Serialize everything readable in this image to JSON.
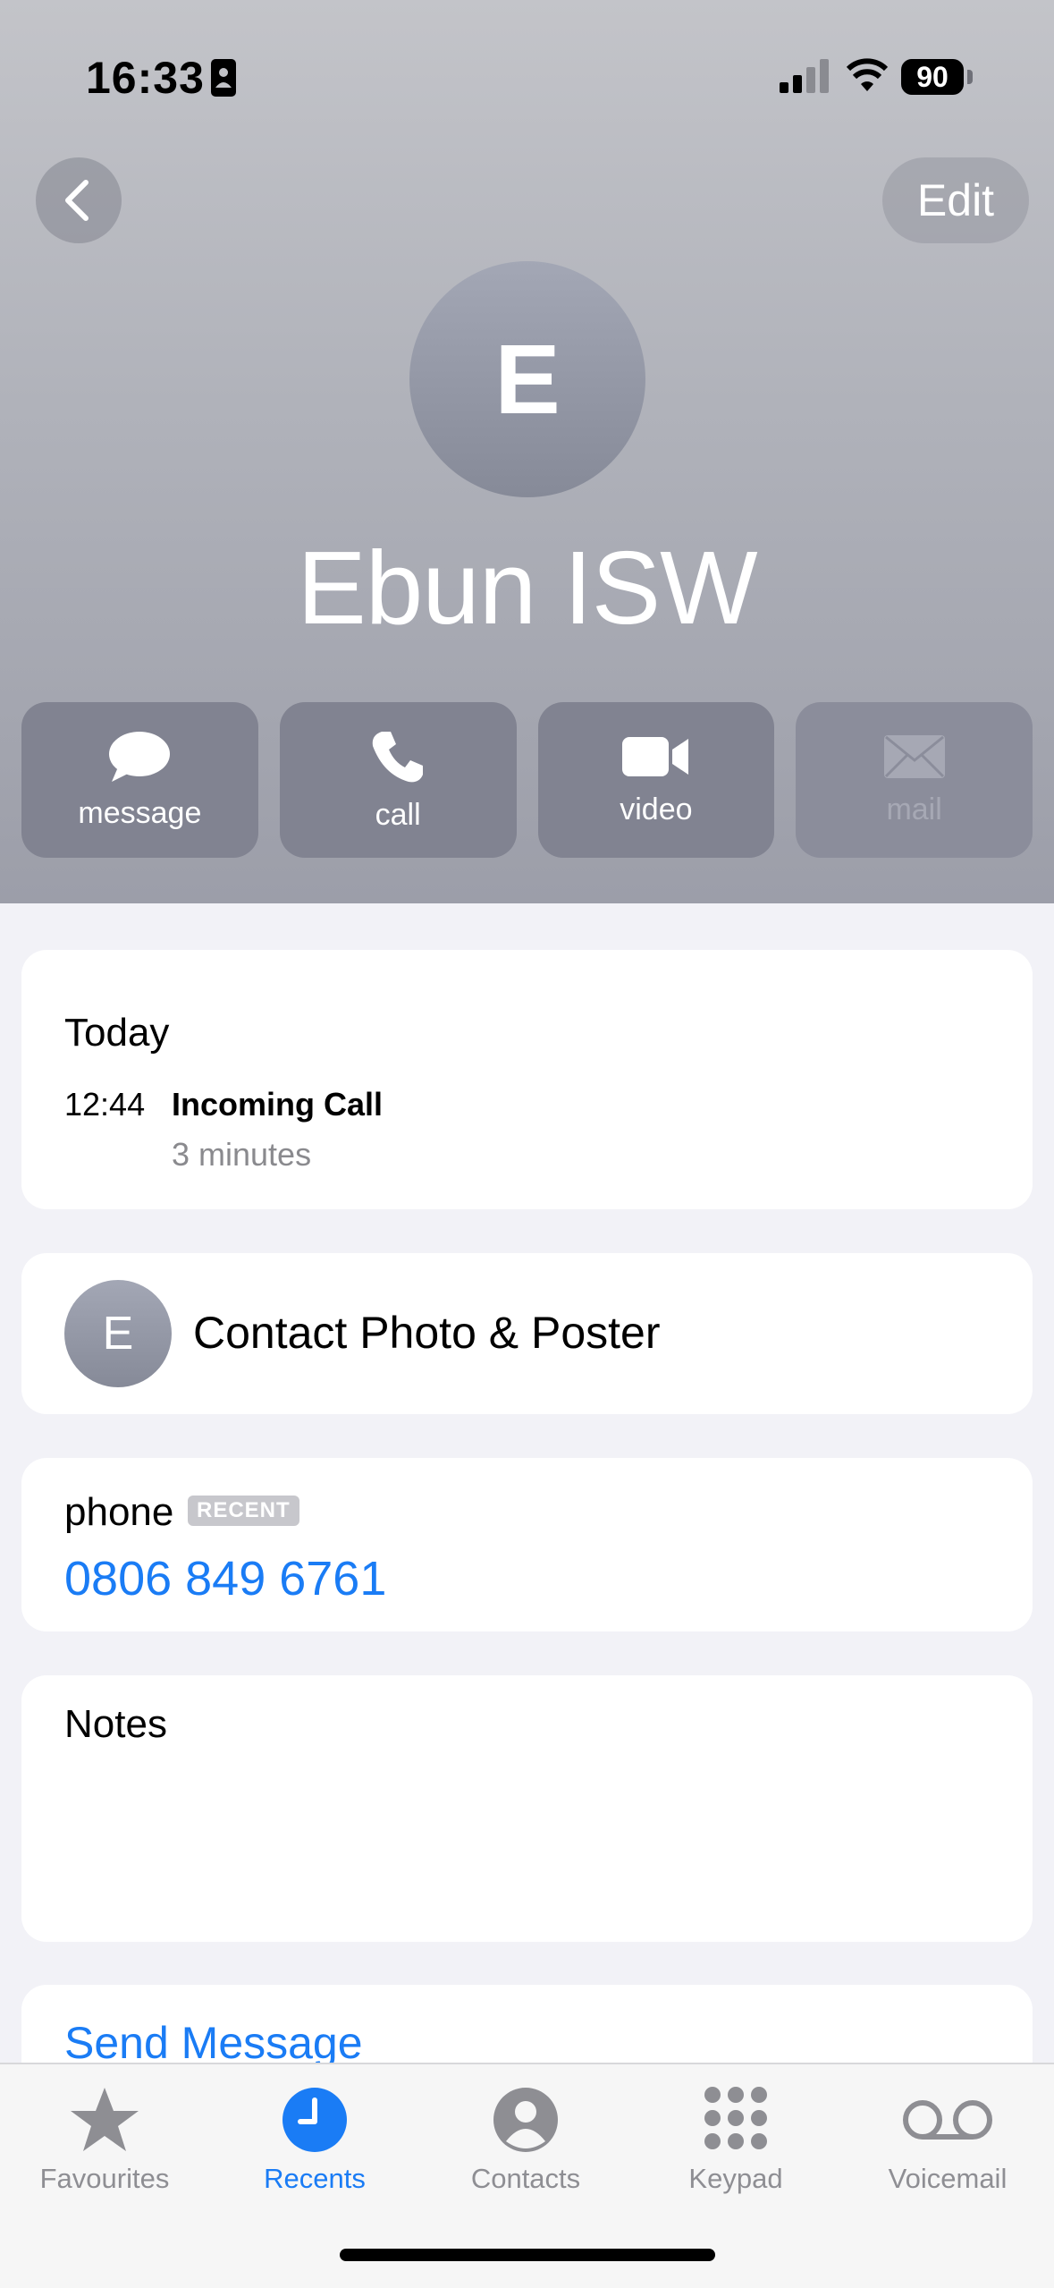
{
  "status_bar": {
    "time": "16:33",
    "battery": "90"
  },
  "nav": {
    "edit_label": "Edit"
  },
  "contact": {
    "initial": "E",
    "name": "Ebun ISW"
  },
  "actions": [
    {
      "label": "message",
      "icon": "message-bubble-icon"
    },
    {
      "label": "call",
      "icon": "phone-icon"
    },
    {
      "label": "video",
      "icon": "video-camera-icon"
    },
    {
      "label": "mail",
      "icon": "envelope-icon",
      "disabled": true
    }
  ],
  "recent": {
    "day": "Today",
    "time": "12:44",
    "type": "Incoming Call",
    "duration": "3 minutes"
  },
  "photo_poster": {
    "initial": "E",
    "label": "Contact Photo & Poster"
  },
  "phone": {
    "label": "phone",
    "badge": "RECENT",
    "number": "0806 849 6761"
  },
  "notes": {
    "label": "Notes"
  },
  "send_message": {
    "label": "Send Message"
  },
  "tab_bar": {
    "tabs": [
      {
        "label": "Favourites",
        "icon": "star-icon"
      },
      {
        "label": "Recents",
        "icon": "clock-icon",
        "active": true
      },
      {
        "label": "Contacts",
        "icon": "person-icon"
      },
      {
        "label": "Keypad",
        "icon": "keypad-icon"
      },
      {
        "label": "Voicemail",
        "icon": "voicemail-icon"
      }
    ]
  },
  "colors": {
    "accent": "#1a7cf5",
    "header_bottom": "#9c9ea9",
    "action_button": "#818391"
  }
}
